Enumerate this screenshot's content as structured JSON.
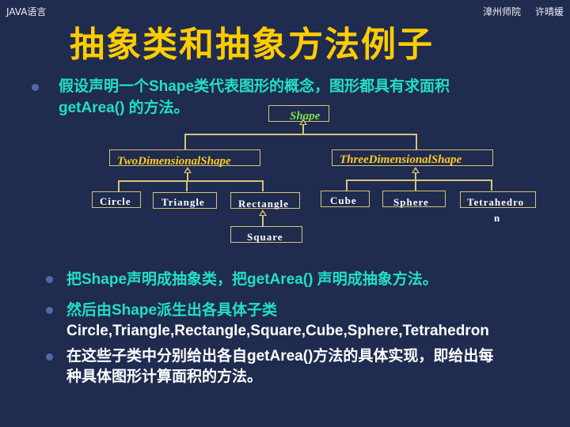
{
  "header": {
    "course": "JAVA语言",
    "school": "漳州师院",
    "author": "许晴媛",
    "title": "抽象类和抽象方法例子"
  },
  "bullets": [
    {
      "lines": [
        "假设声明一个Shape类代表图形的概念，图形都具有求面积",
        "getArea() 的方法。"
      ]
    },
    {
      "lines": [
        "把Shape声明成抽象类，把getArea() 声明成抽象方法。"
      ]
    },
    {
      "lines": [
        "然后由Shape派生出各具体子类",
        "Circle,Triangle,Rectangle,Square,Cube,Sphere,Tetrahedron"
      ]
    },
    {
      "lines": [
        "在这些子类中分别给出各自getArea()方法的具体实现，即给出每",
        "种具体图形计算面积的方法。"
      ]
    }
  ],
  "diagram": {
    "root": {
      "label": "Shape",
      "color": "#7ee04a"
    },
    "abstract": [
      {
        "label": "TwoDimensionalShape",
        "color": "#ffcc22"
      },
      {
        "label": "ThreeDimensionalShape",
        "color": "#ffcc22"
      }
    ],
    "concrete": [
      {
        "label": "Circle"
      },
      {
        "label": "Triangle"
      },
      {
        "label": "Rectangle"
      },
      {
        "label": "Square"
      },
      {
        "label": "Cube"
      },
      {
        "label": "Sphere"
      },
      {
        "label": "Tetrahedro",
        "overflow": "n"
      }
    ]
  },
  "colors": {
    "background": "#1f2b4f",
    "title": "#ffcc00",
    "bullet_text": "#22dfc8",
    "diagram_line": "#d8c478"
  }
}
